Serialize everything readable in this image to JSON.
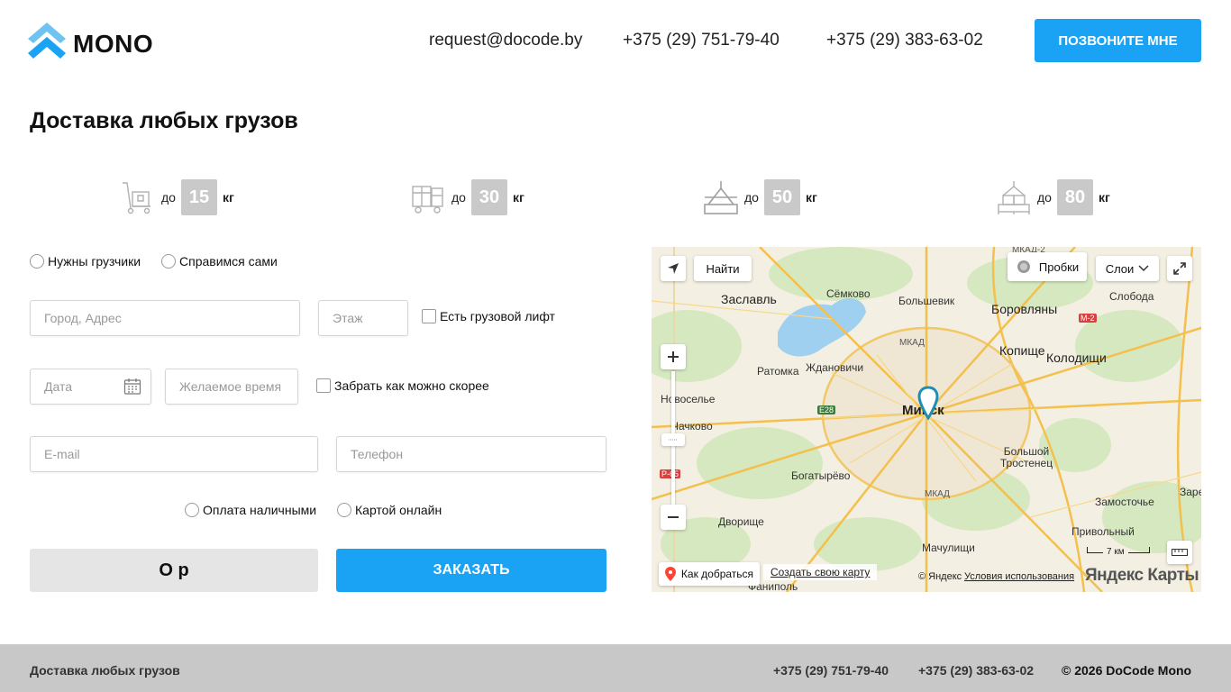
{
  "header": {
    "logo_text": "MONO",
    "email": "request@docode.by",
    "phone1": "+375 (29) 751-79-40",
    "phone2": "+375 (29) 383-63-02",
    "callme_label": "ПОЗВОНИТЕ МНЕ",
    "accent_color": "#1aa3f5"
  },
  "page_title": "Доставка любых грузов",
  "weights": [
    {
      "prefix": "до",
      "value": "15",
      "unit": "кг",
      "icon": "hand-truck-icon"
    },
    {
      "prefix": "до",
      "value": "30",
      "unit": "кг",
      "icon": "forklift-icon"
    },
    {
      "prefix": "до",
      "value": "50",
      "unit": "кг",
      "icon": "crane-load-icon"
    },
    {
      "prefix": "до",
      "value": "80",
      "unit": "кг",
      "icon": "pallet-stack-icon"
    }
  ],
  "form": {
    "movers_options": [
      "Нужны грузчики",
      "Справимся сами"
    ],
    "address_placeholder": "Город, Адрес",
    "floor_placeholder": "Этаж",
    "elevator_label": "Есть грузовой лифт",
    "date_placeholder": "Дата",
    "time_placeholder": "Желаемое время",
    "asap_label": "Забрать как можно скорее",
    "email_placeholder": "E-mail",
    "phone_placeholder": "Телефон",
    "payment_options": [
      "Оплата наличными",
      "Картой онлайн"
    ],
    "captcha_text": "O p",
    "order_label": "ЗАКАЗАТЬ"
  },
  "map": {
    "find_label": "Найти",
    "traffic_label": "Пробки",
    "layers_label": "Слои",
    "route_label": "Как добраться",
    "create_map_label": "Создать свою карту",
    "copyright": "© Яндекс",
    "terms_label": "Условия использования",
    "brand": "Яндекс Карты",
    "scale_label": "7 км",
    "places": {
      "zaslavl": "Заславль",
      "semkovo": "Сёмково",
      "bolshevik": "Большевик",
      "borovlyany": "Боровляны",
      "sloboda": "Слобода",
      "kopische": "Копище",
      "kolodischi": "Колодищи",
      "ratomka": "Ратомка",
      "zhdanovichi": "Ждановичи",
      "novoselye": "Новоселье",
      "minsk": "Минск",
      "chachkovo": "Чачково",
      "bogatyrevo": "Богатырёво",
      "bolshoy_trostenets": "Большой Тростенец",
      "zamostochye": "Замосточье",
      "dvorische": "Дворище",
      "privolny": "Привольный",
      "machulischi": "Мачулищи",
      "fanipol": "Фаниполь",
      "zare": "Заре",
      "mkad": "МКАД",
      "mkad2": "МКАД-2",
      "e28": "E28",
      "m2": "M-2",
      "p65": "Р-65"
    }
  },
  "footer": {
    "title": "Доставка любых грузов",
    "phone1": "+375 (29) 751-79-40",
    "phone2": "+375 (29) 383-63-02",
    "copyright": "© 2026 DoCode Mono"
  }
}
